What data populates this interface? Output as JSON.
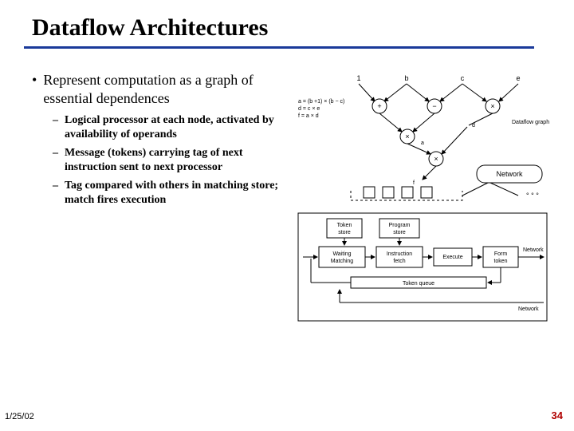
{
  "title": "Dataflow Architectures",
  "bullet": "Represent computation as a graph of essential dependences",
  "sub": [
    "Logical processor at each node, activated by availability of operands",
    "Message (tokens) carrying tag of next instruction sent to next processor",
    "Tag compared with others in matching store; match fires execution"
  ],
  "diagram": {
    "inputs": [
      "1",
      "b",
      "c",
      "e"
    ],
    "eqs": [
      "a = (b +1) × (b − c)",
      "d = c × e",
      "f = a × d"
    ],
    "ops": {
      "plus": "+",
      "minus": "−",
      "times": "×"
    },
    "mids": [
      "a",
      "d",
      "f"
    ],
    "graph_label": "Dataflow graph",
    "network": "Network",
    "dots": "° ° °",
    "boxes": {
      "token_store": "Token store",
      "program_store": "Program store",
      "waiting": "Waiting Matching",
      "ifetch": "Instruction fetch",
      "execute": "Execute",
      "form_token": "Form token",
      "token_queue": "Token queue"
    },
    "net_arrow_in": "Network",
    "net_arrow_out": "Network"
  },
  "footer": {
    "date": "1/25/02",
    "page": "34"
  }
}
